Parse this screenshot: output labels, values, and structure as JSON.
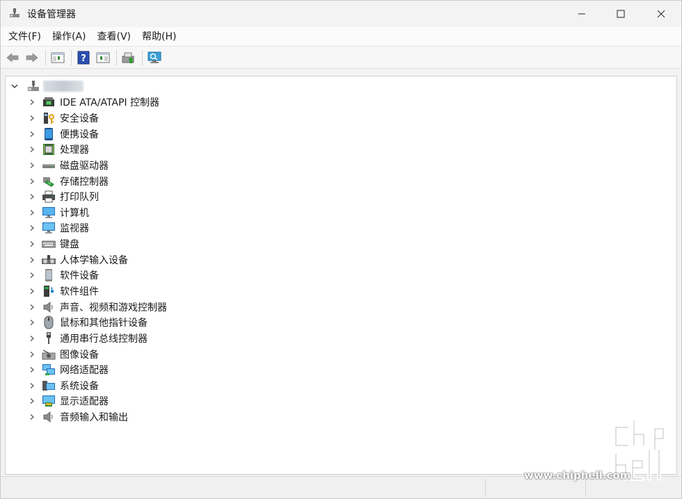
{
  "window": {
    "title": "设备管理器",
    "icon": "device-manager-icon"
  },
  "menu": [
    {
      "label": "文件(F)"
    },
    {
      "label": "操作(A)"
    },
    {
      "label": "查看(V)"
    },
    {
      "label": "帮助(H)"
    }
  ],
  "toolbar": [
    {
      "name": "back-arrow-icon"
    },
    {
      "name": "forward-arrow-icon"
    },
    {
      "name": "show-hide-console-tree-icon"
    },
    {
      "name": "help-icon"
    },
    {
      "name": "show-action-pane-icon"
    },
    {
      "name": "update-driver-icon"
    },
    {
      "name": "scan-hardware-icon"
    }
  ],
  "tree": {
    "root_label_blurred": true,
    "items": [
      {
        "label": "IDE ATA/ATAPI 控制器",
        "icon": "ide-controller-icon"
      },
      {
        "label": "安全设备",
        "icon": "security-device-icon"
      },
      {
        "label": "便携设备",
        "icon": "portable-device-icon"
      },
      {
        "label": "处理器",
        "icon": "processor-icon"
      },
      {
        "label": "磁盘驱动器",
        "icon": "disk-drive-icon"
      },
      {
        "label": "存储控制器",
        "icon": "storage-controller-icon"
      },
      {
        "label": "打印队列",
        "icon": "printer-icon"
      },
      {
        "label": "计算机",
        "icon": "computer-icon"
      },
      {
        "label": "监视器",
        "icon": "monitor-icon"
      },
      {
        "label": "键盘",
        "icon": "keyboard-icon"
      },
      {
        "label": "人体学输入设备",
        "icon": "hid-icon"
      },
      {
        "label": "软件设备",
        "icon": "software-device-icon"
      },
      {
        "label": "软件组件",
        "icon": "software-component-icon"
      },
      {
        "label": "声音、视频和游戏控制器",
        "icon": "sound-icon"
      },
      {
        "label": "鼠标和其他指针设备",
        "icon": "mouse-icon"
      },
      {
        "label": "通用串行总线控制器",
        "icon": "usb-icon"
      },
      {
        "label": "图像设备",
        "icon": "imaging-device-icon"
      },
      {
        "label": "网络适配器",
        "icon": "network-adapter-icon"
      },
      {
        "label": "系统设备",
        "icon": "system-device-icon"
      },
      {
        "label": "显示适配器",
        "icon": "display-adapter-icon"
      },
      {
        "label": "音频输入和输出",
        "icon": "audio-io-icon"
      }
    ]
  },
  "watermark": {
    "logo": "chiphell",
    "url": "www.chiphell.com"
  }
}
